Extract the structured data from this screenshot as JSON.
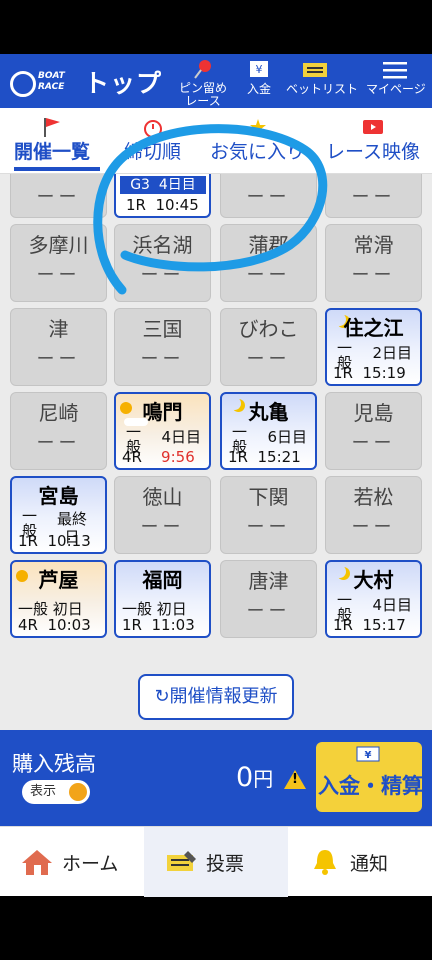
{
  "header": {
    "logo_line1": "BOAT",
    "logo_line2": "RACE",
    "title": "トップ",
    "icons": [
      {
        "label": "ピン留め\nレース",
        "icon": "pin-icon"
      },
      {
        "label": "入金",
        "icon": "atm-icon"
      },
      {
        "label": "ベットリスト",
        "icon": "ticket-icon"
      },
      {
        "label": "マイページ",
        "icon": "menu-icon"
      }
    ]
  },
  "tabs": [
    {
      "label": "開催一覧",
      "icon": "flag-icon",
      "active": true
    },
    {
      "label": "締切順",
      "icon": "clock-icon"
    },
    {
      "label": "お気に入り",
      "icon": "star-icon"
    },
    {
      "label": "レース映像",
      "icon": "video-icon"
    }
  ],
  "g3card": {
    "grade": "G3",
    "day": "4日目",
    "race": "1R",
    "time": "10:45"
  },
  "venues": [
    {
      "name": "多摩川",
      "status": "ーー"
    },
    {
      "name": "浜名湖",
      "status": "ーー"
    },
    {
      "name": "蒲郡",
      "status": "ーー"
    },
    {
      "name": "常滑",
      "status": "ーー"
    },
    {
      "name": "津",
      "status": "ーー"
    },
    {
      "name": "三国",
      "status": "ーー"
    },
    {
      "name": "びわこ",
      "status": "ーー"
    },
    {
      "name": "住之江",
      "grade": "一般",
      "day": "2日目",
      "race": "1R",
      "time": "15:19"
    },
    {
      "name": "尼崎",
      "status": "ーー"
    },
    {
      "name": "鳴門",
      "grade": "一般",
      "day": "4日目",
      "race": "4R",
      "time": "9:56"
    },
    {
      "name": "丸亀",
      "grade": "一般",
      "day": "6日目",
      "race": "1R",
      "time": "15:21"
    },
    {
      "name": "児島",
      "status": "ーー"
    },
    {
      "name": "宮島",
      "grade": "一般",
      "day": "最終日",
      "race": "1R",
      "time": "10:13"
    },
    {
      "name": "徳山",
      "status": "ーー"
    },
    {
      "name": "下関",
      "status": "ーー"
    },
    {
      "name": "若松",
      "status": "ーー"
    },
    {
      "name": "芦屋",
      "grade": "一般",
      "day": "初日",
      "race": "4R",
      "time": "10:03"
    },
    {
      "name": "福岡",
      "grade": "一般",
      "day": "初日",
      "race": "1R",
      "time": "11:03"
    },
    {
      "name": "唐津",
      "status": "ーー"
    },
    {
      "name": "大村",
      "grade": "一般",
      "day": "4日目",
      "race": "1R",
      "time": "15:17"
    }
  ],
  "row0_status": "ーー",
  "refresh_label": "開催情報更新",
  "balance": {
    "label": "購入残高",
    "toggle_label": "表示",
    "amount": "0",
    "unit": "円",
    "deposit_label": "入金・精算"
  },
  "bottom_nav": [
    {
      "label": "ホーム",
      "icon": "home-icon"
    },
    {
      "label": "投票",
      "icon": "vote-icon",
      "active": true
    },
    {
      "label": "通知",
      "icon": "bell-icon"
    }
  ],
  "colors": {
    "brand": "#1f4fc6",
    "accent": "#f4d13a",
    "annotation": "#1e9be6",
    "late_time": "#e0302b"
  }
}
